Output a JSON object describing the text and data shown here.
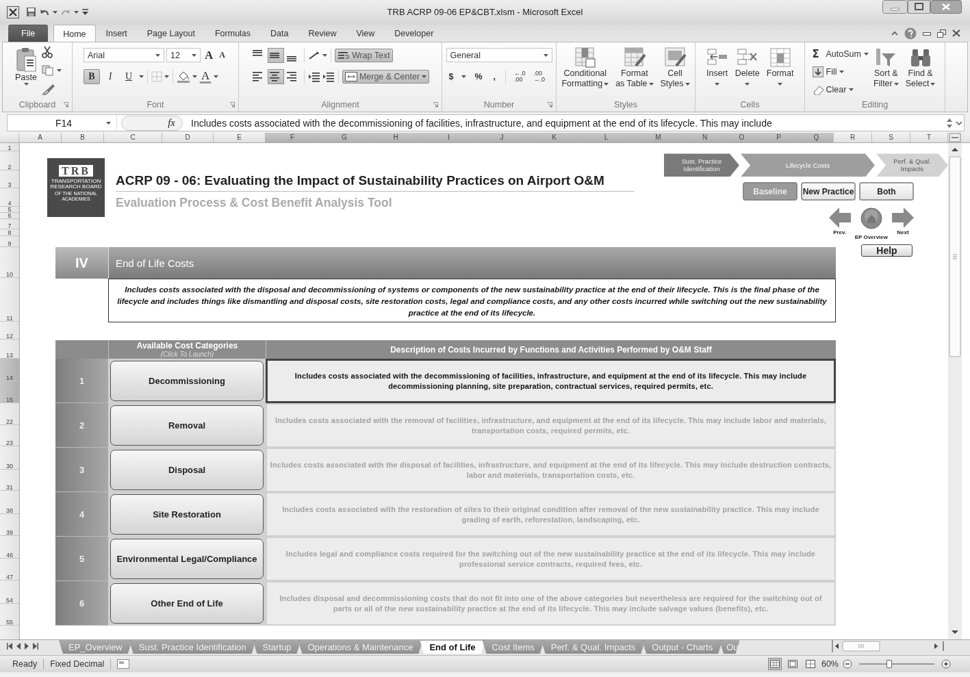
{
  "window": {
    "title": "TRB ACRP 09-06 EP&CBT.xlsm  -  Microsoft Excel"
  },
  "ribbon_tabs": [
    {
      "label": "File",
      "kind": "file",
      "selected": false
    },
    {
      "label": "Home",
      "kind": "tab",
      "selected": true
    },
    {
      "label": "Insert",
      "kind": "tab",
      "selected": false
    },
    {
      "label": "Page Layout",
      "kind": "tab",
      "selected": false
    },
    {
      "label": "Formulas",
      "kind": "tab",
      "selected": false
    },
    {
      "label": "Data",
      "kind": "tab",
      "selected": false
    },
    {
      "label": "Review",
      "kind": "tab",
      "selected": false
    },
    {
      "label": "View",
      "kind": "tab",
      "selected": false
    },
    {
      "label": "Developer",
      "kind": "tab",
      "selected": false
    }
  ],
  "ribbon": {
    "groups": [
      {
        "kind": "clipboard",
        "label": "Clipboard",
        "paste": "Paste"
      },
      {
        "kind": "font",
        "label": "Font",
        "font_name": "Arial",
        "font_size": "12",
        "grow": "A",
        "shrink": "A",
        "styles": [
          {
            "label": "B",
            "selected": true
          },
          {
            "label": "I",
            "selected": false
          },
          {
            "label": "U",
            "selected": false
          }
        ],
        "font_color": "A"
      },
      {
        "kind": "alignment",
        "label": "Alignment",
        "vertical": [
          {
            "selected": false
          },
          {
            "selected": true
          },
          {
            "selected": false
          }
        ],
        "horizontal": [
          {
            "selected": false
          },
          {
            "selected": true
          },
          {
            "selected": false
          }
        ],
        "wrap_text": {
          "label": "Wrap Text",
          "selected": true
        },
        "merge": {
          "label": "Merge & Center",
          "selected": true
        }
      },
      {
        "kind": "number",
        "label": "Number",
        "format": "General",
        "symbols": [
          "$",
          "%",
          ","
        ],
        "decimals": [
          {
            "top": "←.0",
            "bottom": ".00"
          },
          {
            "top": ".00",
            "bottom": "→.0"
          }
        ]
      },
      {
        "kind": "styles",
        "label": "Styles",
        "buttons": [
          {
            "lines": [
              "Conditional",
              "Formatting"
            ]
          },
          {
            "lines": [
              "Format",
              "as Table"
            ]
          },
          {
            "lines": [
              "Cell",
              "Styles"
            ]
          }
        ]
      },
      {
        "kind": "cells",
        "label": "Cells",
        "buttons": [
          {
            "lines": [
              "Insert"
            ]
          },
          {
            "lines": [
              "Delete"
            ]
          },
          {
            "lines": [
              "Format"
            ]
          }
        ]
      },
      {
        "kind": "editing",
        "label": "Editing",
        "small": [
          {
            "label": "AutoSum",
            "symbol": "Σ"
          },
          {
            "label": "Fill"
          },
          {
            "label": "Clear"
          }
        ],
        "large": [
          {
            "lines": [
              "Sort &",
              "Filter"
            ]
          },
          {
            "lines": [
              "Find &",
              "Select"
            ]
          }
        ]
      }
    ]
  },
  "formula_bar": {
    "cell": "F14",
    "fx": "fx",
    "formula": "Includes costs associated with the decommissioning of facilities, infrastructure, and equipment at the end of its lifecycle. This may include"
  },
  "columns": [
    {
      "label": "A",
      "selected": false
    },
    {
      "label": "B",
      "selected": false
    },
    {
      "label": "C",
      "selected": false
    },
    {
      "label": "D",
      "selected": false
    },
    {
      "label": "E",
      "selected": false
    },
    {
      "label": "F",
      "selected": true
    },
    {
      "label": "G",
      "selected": true
    },
    {
      "label": "H",
      "selected": true
    },
    {
      "label": "I",
      "selected": true
    },
    {
      "label": "J",
      "selected": true
    },
    {
      "label": "K",
      "selected": true
    },
    {
      "label": "L",
      "selected": true
    },
    {
      "label": "M",
      "selected": true
    },
    {
      "label": "N",
      "selected": true
    },
    {
      "label": "O",
      "selected": true
    },
    {
      "label": "P",
      "selected": true
    },
    {
      "label": "Q",
      "selected": true
    },
    {
      "label": "R",
      "selected": false
    },
    {
      "label": "S",
      "selected": false
    },
    {
      "label": "T",
      "selected": false
    }
  ],
  "rows": [
    {
      "label": "1",
      "selected": false
    },
    {
      "label": "2",
      "selected": false
    },
    {
      "label": "3",
      "selected": false
    },
    {
      "label": "4",
      "selected": false
    },
    {
      "label": "5",
      "selected": false
    },
    {
      "label": "6",
      "selected": false
    },
    {
      "label": "7",
      "selected": false
    },
    {
      "label": "8",
      "selected": false
    },
    {
      "label": "9",
      "selected": false
    },
    {
      "label": "10",
      "selected": false
    },
    {
      "label": "11",
      "selected": false
    },
    {
      "label": "12",
      "selected": false
    },
    {
      "label": "13",
      "selected": false
    },
    {
      "label": "14",
      "selected": true
    },
    {
      "label": "15",
      "selected": true
    },
    {
      "label": "22",
      "selected": false
    },
    {
      "label": "23",
      "selected": false
    },
    {
      "label": "30",
      "selected": false
    },
    {
      "label": "31",
      "selected": false
    },
    {
      "label": "38",
      "selected": false
    },
    {
      "label": "39",
      "selected": false
    },
    {
      "label": "46",
      "selected": false
    },
    {
      "label": "47",
      "selected": false
    },
    {
      "label": "54",
      "selected": false
    },
    {
      "label": "55",
      "selected": false
    }
  ],
  "header": {
    "logo_text": "TRB",
    "logo_lines": [
      "TRANSPORTATION",
      "RESEARCH BOARD",
      "OF THE NATIONAL ACADEMIES"
    ],
    "title": "ACRP 09 - 06: Evaluating the Impact of Sustainability Practices on Airport O&M",
    "subtitle": "Evaluation Process & Cost Benefit Analysis Tool"
  },
  "progress_steps": [
    {
      "label": "Sust. Practice Identification",
      "kind": "done"
    },
    {
      "label": "Lifecycle Costs",
      "kind": "current"
    },
    {
      "label": "Perf. & Qual. Impacts",
      "kind": "upcoming"
    }
  ],
  "view_buttons": [
    {
      "label": "Baseline",
      "selected": true
    },
    {
      "label": "New Practice",
      "selected": false
    },
    {
      "label": "Both",
      "selected": false
    }
  ],
  "navigation": {
    "prev": "Prev.",
    "home": "EP Overview",
    "next": "Next",
    "help": "Help"
  },
  "section": {
    "number": "IV",
    "title": "End of Life Costs",
    "description": "Includes costs associated with the disposal and decommissioning of systems or components of the new sustainability practice at the end of their lifecycle. This is the final phase of the lifecycle and includes things like dismantling and disposal costs, site restoration costs, legal and compliance costs, and any other costs incurred while switching out the new sustainability practice at the end of its lifecycle."
  },
  "cost_table": {
    "category_header": "Available Cost Categories",
    "category_hint": "(Click To Launch)",
    "description_header": "Description of Costs Incurred by Functions and Activities Performed by O&M Staff",
    "rows": [
      {
        "number": "1",
        "category": "Decommissioning",
        "description": "Includes costs associated with the decommissioning of facilities, infrastructure, and equipment at the end of its lifecycle. This may include decommissioning planning, site preparation, contractual services, required permits, etc.",
        "selected": true
      },
      {
        "number": "2",
        "category": "Removal",
        "description": "Includes costs associated with the removal of facilities, infrastructure, and equipment at the end of its lifecycle. This may include labor and materials, transportation costs, required permits, etc.",
        "selected": false
      },
      {
        "number": "3",
        "category": "Disposal",
        "description": "Includes costs associated with the disposal of facilities, infrastructure, and equipment at the end of its lifecycle. This may include destruction contracts, labor and materials, transportation costs, etc.",
        "selected": false
      },
      {
        "number": "4",
        "category": "Site Restoration",
        "description": "Includes costs associated with the restoration of sites to their original condition after removal of the new sustainability practice. This may include grading of earth, reforestation, landscaping, etc.",
        "selected": false
      },
      {
        "number": "5",
        "category": "Environmental Legal/Compliance",
        "description": "Includes legal and compliance costs required for the switching out of the new sustainability practice at the end of its lifecycle. This may include professional service contracts, required fees, etc.",
        "selected": false
      },
      {
        "number": "6",
        "category": "Other End of Life",
        "description": "Includes disposal and decommissioning costs that do not fit into one of the above categories but nevertheless are required for the switching out of parts or all of the new sustainability practice at the end of its lifecycle. This may include salvage values (benefits), etc.",
        "selected": false
      }
    ]
  },
  "sheet_tabs": [
    {
      "label": "EP_Overview",
      "selected": false
    },
    {
      "label": "Sust. Practice Identification",
      "selected": false
    },
    {
      "label": "Startup",
      "selected": false
    },
    {
      "label": "Operations & Maintenance",
      "selected": false
    },
    {
      "label": "End of Life",
      "selected": true
    },
    {
      "label": "Cost Items",
      "selected": false
    },
    {
      "label": "Perf. & Qual. Impacts",
      "selected": false
    },
    {
      "label": "Output - Charts",
      "selected": false
    },
    {
      "label": "Ou",
      "selected": false
    }
  ],
  "status_bar": {
    "mode": "Ready",
    "indicator": "Fixed Decimal",
    "view_modes": [
      {
        "selected": true
      },
      {
        "selected": false
      },
      {
        "selected": false
      }
    ],
    "zoom": "60%",
    "zoom_slider": {
      "level": 0.4
    }
  }
}
